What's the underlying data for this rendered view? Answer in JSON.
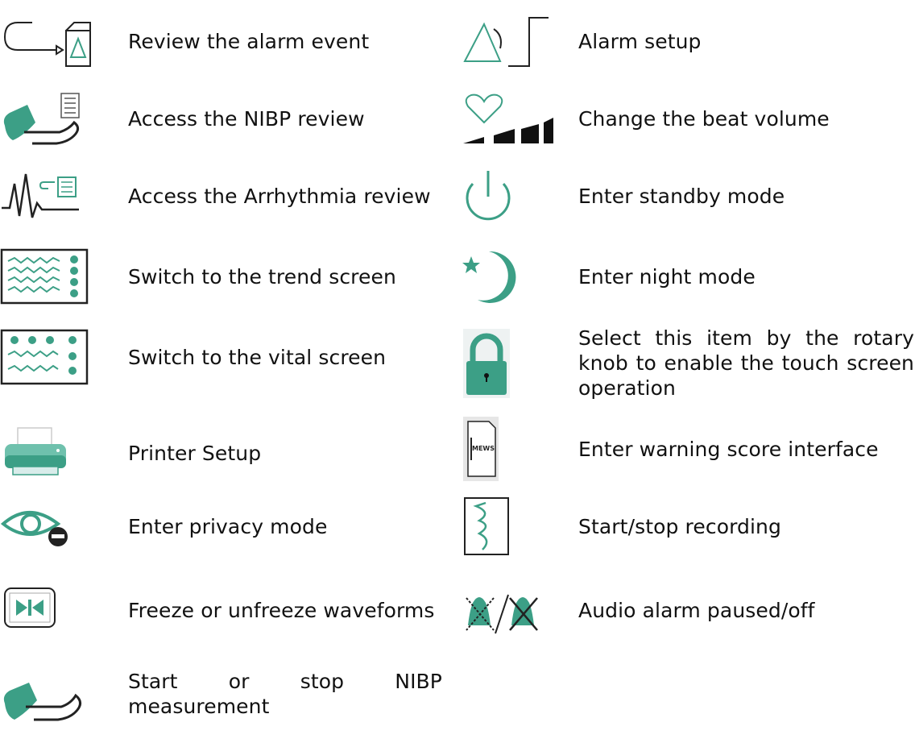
{
  "colors": {
    "teal": "#3c9f86",
    "stroke": "#1e1e1e"
  },
  "items": [
    {
      "icon": "alarm-review-icon",
      "text": "Review the alarm event"
    },
    {
      "icon": "alarm-setup-icon",
      "text": "Alarm setup"
    },
    {
      "icon": "nibp-review-icon",
      "text": "Access the NIBP review"
    },
    {
      "icon": "beat-volume-icon",
      "text": "Change the beat volume"
    },
    {
      "icon": "arrhythmia-review-icon",
      "text": "Access the Arrhythmia review"
    },
    {
      "icon": "standby-icon",
      "text": "Enter standby mode"
    },
    {
      "icon": "trend-screen-icon",
      "text": "Switch to the trend screen"
    },
    {
      "icon": "night-mode-icon",
      "text": "Enter night mode"
    },
    {
      "icon": "vital-screen-icon",
      "text": "Switch to the vital screen"
    },
    {
      "icon": "lock-icon",
      "text": "Select this item by the rotary knob to enable the touch screen operation"
    },
    {
      "icon": "printer-icon",
      "text": "Printer Setup"
    },
    {
      "icon": "mews-icon",
      "text": "Enter warning score interface"
    },
    {
      "icon": "privacy-eye-icon",
      "text": "Enter privacy mode"
    },
    {
      "icon": "record-icon",
      "text": "Start/stop recording"
    },
    {
      "icon": "freeze-icon",
      "text": "Freeze or unfreeze waveforms"
    },
    {
      "icon": "audio-paused-off-icon",
      "text": "Audio alarm paused/off"
    },
    {
      "icon": "nibp-cuff-icon",
      "text": "Start or stop NIBP measurement"
    }
  ]
}
